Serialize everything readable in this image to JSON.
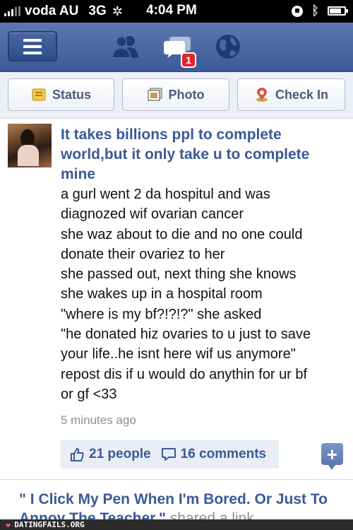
{
  "status_bar": {
    "carrier": "voda AU",
    "network": "3G",
    "time": "4:04 PM"
  },
  "nav": {
    "notification_count": "1",
    "icons": [
      "menu-icon",
      "friend-requests-icon",
      "messages-icon",
      "notifications-globe-icon"
    ]
  },
  "actions": {
    "status_label": "Status",
    "photo_label": "Photo",
    "checkin_label": "Check In"
  },
  "story": {
    "title": "It takes billions ppl to complete world,but it only take u to complete mine",
    "body_lines": [
      "a gurl went 2 da hospitul and was",
      "diagnozed wif ovarian cancer",
      "she waz about to die and no one could",
      "donate their ovariez to her",
      "she passed out, next thing she knows",
      "she wakes up in a hospital room",
      "\"where is my bf?!?!?\" she asked",
      "\"he donated hiz ovaries to u just to save",
      "your life..he isnt here wif us anymore\"",
      "repost dis if u would do anythin for ur bf",
      "or gf <33"
    ],
    "time": "5 minutes ago",
    "likes": "21 people",
    "comments": "16 comments"
  },
  "next_story": {
    "title": "\" I Click My Pen When I'm Bored. Or Just To Annoy The Teacher.\"",
    "suffix": " shared a link"
  },
  "watermark": "DATINGFAILS.ORG",
  "colors": {
    "brand_blue": "#3b5998",
    "nav_bg": "#4a66a6",
    "badge_red": "#e0262a"
  }
}
